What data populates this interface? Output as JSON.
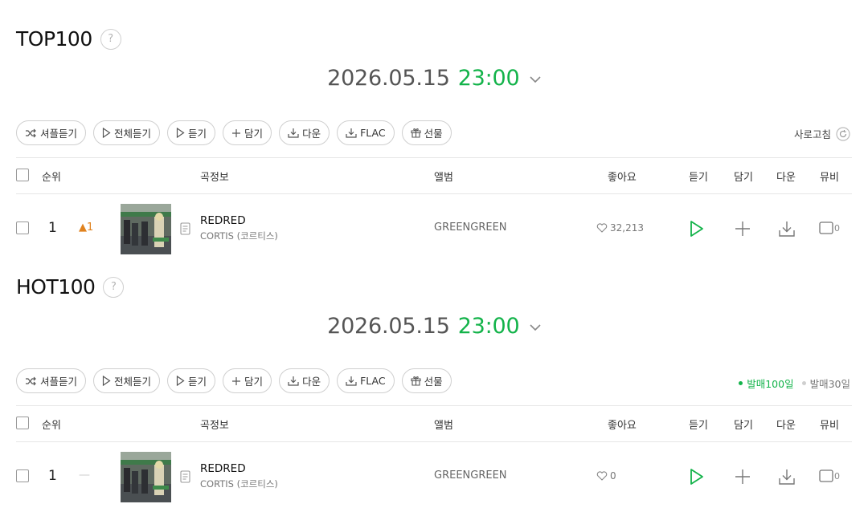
{
  "top100": {
    "title": "TOP100",
    "help": "?",
    "date": "2026.05.15",
    "time": "23:00",
    "buttons": [
      "셔플듣기",
      "전체듣기",
      "듣기",
      "담기",
      "다운",
      "FLAC",
      "선물"
    ],
    "refresh_label": "사로고침",
    "columns": {
      "rank": "순위",
      "song": "곡정보",
      "album": "앨범",
      "likes": "좋아요",
      "listen": "듣기",
      "add": "담기",
      "down": "다운",
      "mv": "뮤비"
    },
    "rows": [
      {
        "rank": "1",
        "change": "▲1",
        "title": "REDRED",
        "artist": "CORTIS (코르티스)",
        "album": "GREENGREEN",
        "likes": "32,213",
        "mv_count": "0"
      }
    ]
  },
  "hot100": {
    "title": "HOT100",
    "help": "?",
    "date": "2026.05.15",
    "time": "23:00",
    "buttons": [
      "셔플듣기",
      "전체듣기",
      "듣기",
      "담기",
      "다운",
      "FLAC",
      "선물"
    ],
    "toggles": [
      "발매100일",
      "발매30일"
    ],
    "columns": {
      "rank": "순위",
      "song": "곡정보",
      "album": "앨범",
      "likes": "좋아요",
      "listen": "듣기",
      "add": "담기",
      "down": "다운",
      "mv": "뮤비"
    },
    "rows": [
      {
        "rank": "1",
        "change": "—",
        "title": "REDRED",
        "artist": "CORTIS (코르티스)",
        "album": "GREENGREEN",
        "likes": "0",
        "mv_count": "0"
      }
    ]
  },
  "icons": [
    "help-icon",
    "chevron-down-icon",
    "shuffle-icon",
    "play-icon",
    "plus-icon",
    "download-icon",
    "gift-icon",
    "refresh-icon",
    "heart-icon",
    "lyrics-icon",
    "mv-icon"
  ],
  "colors": {
    "accent_green": "#13b34a",
    "rank_up": "#e0821e",
    "text": "#333333",
    "border": "#cfcfcf"
  }
}
